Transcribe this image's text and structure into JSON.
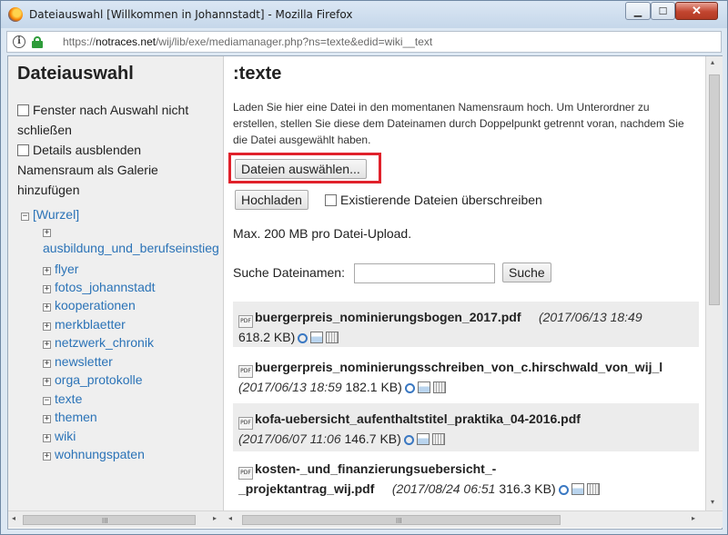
{
  "window": {
    "title": "Dateiauswahl [Willkommen in Johannstadt] - Mozilla Firefox",
    "minimize_label": "▁",
    "maximize_label": "☐",
    "close_label": "✕"
  },
  "urlbar": {
    "url_prefix": "https://",
    "url_domain": "notraces.net",
    "url_path": "/wij/lib/exe/mediamanager.php?ns=texte&edid=wiki__text"
  },
  "sidebar": {
    "title": "Dateiauswahl",
    "option_keep_open": "Fenster nach Auswahl nicht schließen",
    "option_hide_details": "Details ausblenden",
    "option_gallery": "Namensraum als Galerie hinzufügen",
    "tree_root": "[Wurzel]",
    "tree": [
      {
        "label": "ausbildung_und_berufseinstieg",
        "toggle": "+"
      },
      {
        "label": "flyer",
        "toggle": "+"
      },
      {
        "label": "fotos_johannstadt",
        "toggle": "+"
      },
      {
        "label": "kooperationen",
        "toggle": "+"
      },
      {
        "label": "merkblaetter",
        "toggle": "+"
      },
      {
        "label": "netzwerk_chronik",
        "toggle": "+"
      },
      {
        "label": "newsletter",
        "toggle": "+"
      },
      {
        "label": "orga_protokolle",
        "toggle": "+"
      },
      {
        "label": "texte",
        "toggle": "−"
      },
      {
        "label": "themen",
        "toggle": "+"
      },
      {
        "label": "wiki",
        "toggle": "+"
      },
      {
        "label": "wohnungspaten",
        "toggle": "+"
      }
    ]
  },
  "main": {
    "namespace_title": ":texte",
    "help_text": "Laden Sie hier eine Datei in den momentanen Namensraum hoch. Um Unterordner zu erstellen, stellen Sie diese dem Dateinamen durch Doppelpunkt getrennt voran, nachdem Sie die Datei ausgewählt haben.",
    "choose_files_label": "Dateien auswählen...",
    "upload_label": "Hochladen",
    "overwrite_label": "Existierende Dateien überschreiben",
    "max_size_text": "Max. 200 MB pro Datei-Upload.",
    "search_label": "Suche Dateinamen:",
    "search_value": "",
    "search_button_label": "Suche",
    "files": [
      {
        "name": "buergerpreis_nominierungsbogen_2017.pdf",
        "date": "(2017/06/13 18:49",
        "size": "618.2 KB)"
      },
      {
        "name": "buergerpreis_nominierungsschreiben_von_c.hirschwald_von_wij_l",
        "date": "(2017/06/13 18:59",
        "size": "182.1 KB)"
      },
      {
        "name": "kofa-uebersicht_aufenthaltstitel_praktika_04-2016.pdf",
        "date": "(2017/06/07 11:06",
        "size": "146.7 KB)"
      },
      {
        "name_line1": "kosten-_und_finanzierungsuebersicht_-",
        "name_line2": "_projektantrag_wij.pdf",
        "date": "(2017/08/24 06:51",
        "size": "316.3 KB)"
      }
    ]
  },
  "scroll": {
    "grip": "III",
    "left": "◂",
    "right": "▸",
    "up": "▴",
    "down": "▾"
  },
  "colors": {
    "highlight": "#e0212b",
    "link": "#2b73b7",
    "alt_row": "#ececec"
  }
}
